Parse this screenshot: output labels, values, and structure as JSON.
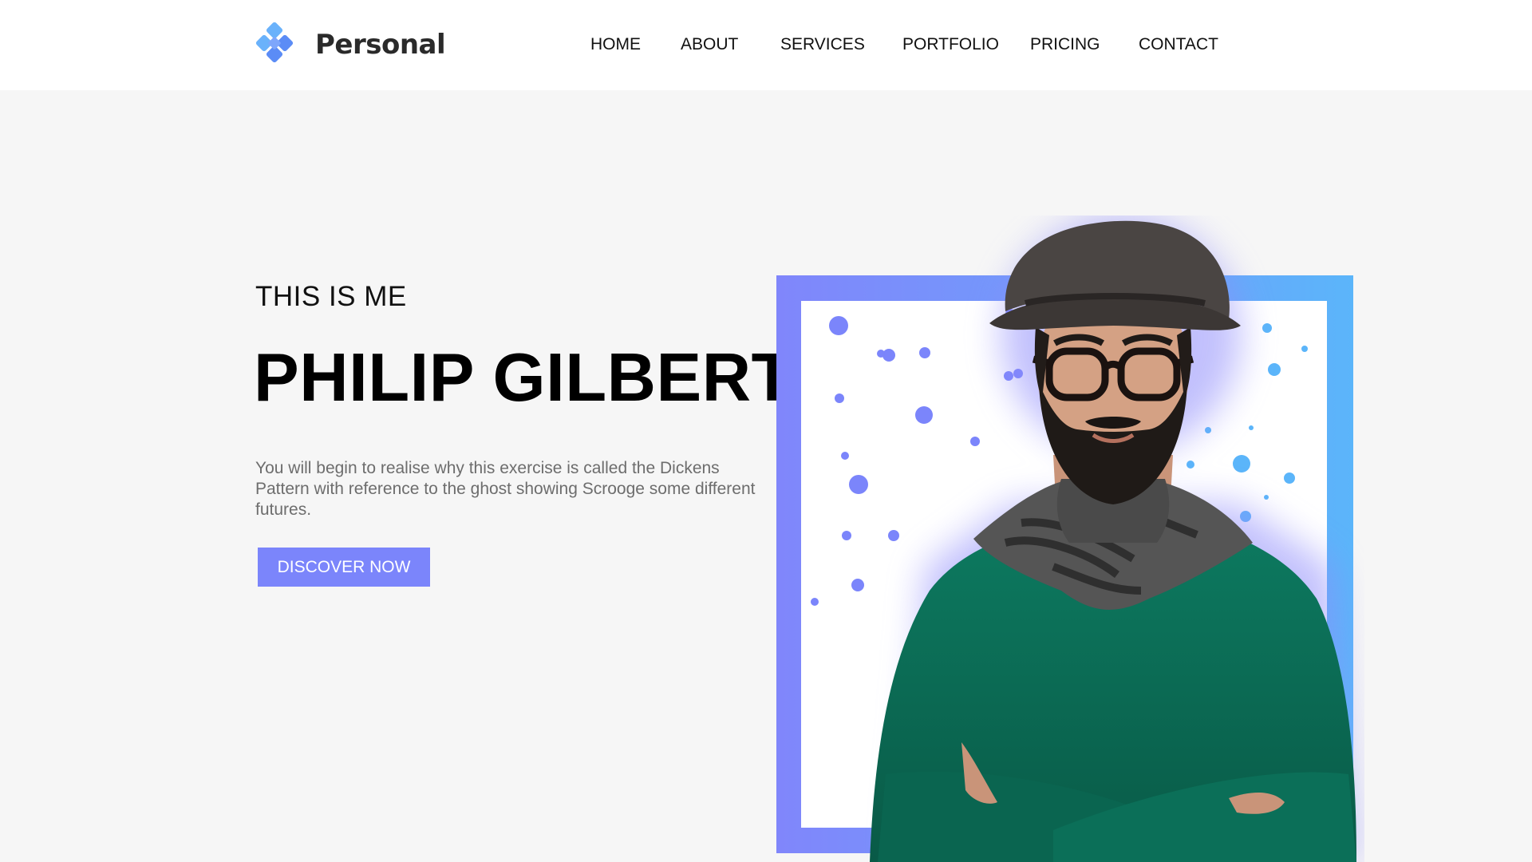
{
  "brand": {
    "name": "Personal",
    "colors": {
      "mark_light": "#6ab2fb",
      "mark_dark": "#5b8cf6",
      "text": "#2a2a2a"
    }
  },
  "nav": {
    "items": [
      {
        "label": "HOME"
      },
      {
        "label": "ABOUT"
      },
      {
        "label": "SERVICES"
      },
      {
        "label": "PORTFOLIO"
      },
      {
        "label": "PRICING"
      },
      {
        "label": "CONTACT"
      }
    ]
  },
  "hero": {
    "eyebrow": "THIS IS ME",
    "name": "PHILIP GILBERT",
    "description": "You will begin to realise why this exercise is called the Dickens Pattern with reference to the ghost showing Scrooge some different futures.",
    "cta_label": "DISCOVER NOW",
    "accent": "#7b85fb"
  },
  "portrait": {
    "frame_gradient": [
      "#8086fb",
      "#5bb5fa"
    ],
    "sweater_color": "#0b6b55",
    "hat_color": "#4a4543",
    "scarf_color": "#4e4e4e"
  }
}
